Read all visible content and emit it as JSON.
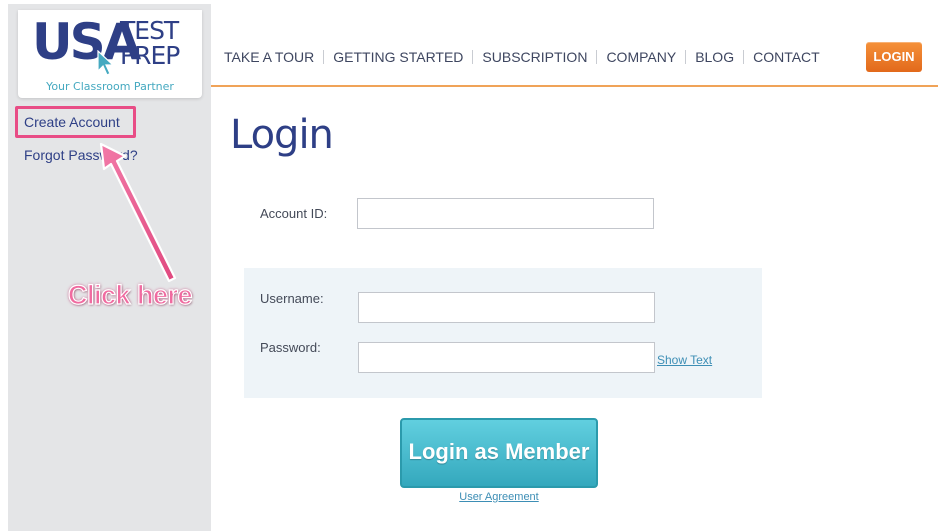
{
  "logo": {
    "brand_usa": "USA",
    "brand_test": "TEST",
    "brand_prep": "PREP",
    "tagline": "Your Classroom Partner"
  },
  "sidebar": {
    "create_account": "Create Account",
    "forgot_password": "Forgot Password?"
  },
  "annotation": {
    "callout": "Click here",
    "color": "#e84d86"
  },
  "nav": {
    "items": [
      "TAKE A TOUR",
      "GETTING STARTED",
      "SUBSCRIPTION",
      "COMPANY",
      "BLOG",
      "CONTACT"
    ],
    "login_button": "LOGIN"
  },
  "main": {
    "title": "Login",
    "account_id_label": "Account ID:",
    "username_label": "Username:",
    "password_label": "Password:",
    "show_text": "Show Text",
    "submit_label": "Login as Member",
    "user_agreement": "User Agreement"
  },
  "colors": {
    "brand_navy": "#2e3f86",
    "accent_orange": "#f08a2e",
    "button_teal": "#45b8cb",
    "sidebar_gray": "#e4e5e7"
  }
}
